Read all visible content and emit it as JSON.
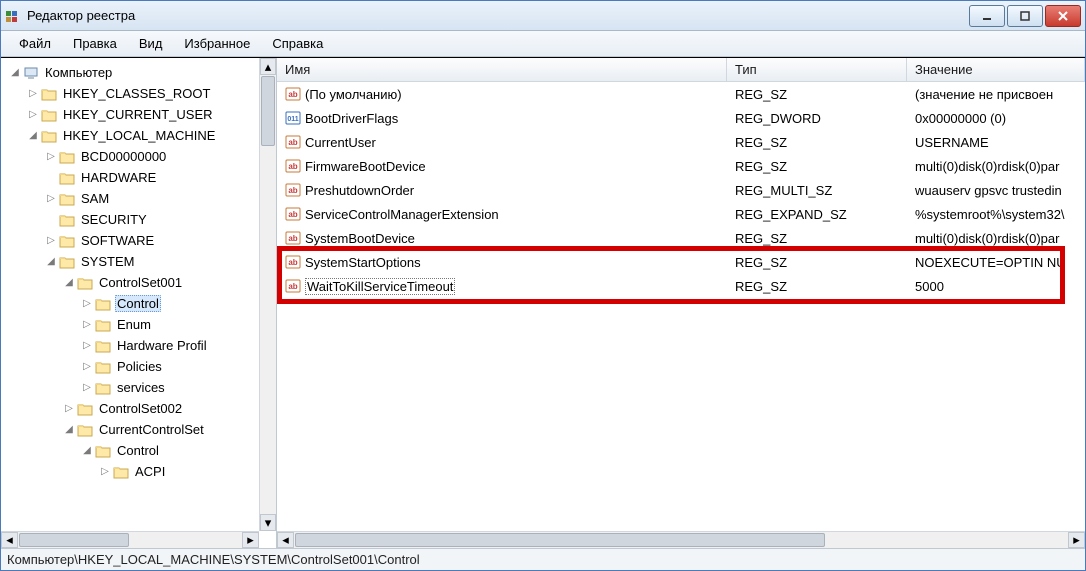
{
  "window": {
    "title": "Редактор реестра"
  },
  "menu": {
    "file": "Файл",
    "edit": "Правка",
    "view": "Вид",
    "favorites": "Избранное",
    "help": "Справка"
  },
  "tree": {
    "root": "Компьютер",
    "hkcr": "HKEY_CLASSES_ROOT",
    "hkcu": "HKEY_CURRENT_USER",
    "hklm": "HKEY_LOCAL_MACHINE",
    "bcd": "BCD00000000",
    "hardware": "HARDWARE",
    "sam": "SAM",
    "security": "SECURITY",
    "software": "SOFTWARE",
    "system": "SYSTEM",
    "cs001": "ControlSet001",
    "control": "Control",
    "enum": "Enum",
    "hwprofile": "Hardware Profil",
    "policies": "Policies",
    "services": "services",
    "cs002": "ControlSet002",
    "ccs": "CurrentControlSet",
    "control2": "Control",
    "acpi": "ACPI"
  },
  "list": {
    "headers": {
      "name": "Имя",
      "type": "Тип",
      "value": "Значение"
    },
    "rows": [
      {
        "name": "(По умолчанию)",
        "type": "REG_SZ",
        "value": "(значение не присвоен",
        "icon": "sz"
      },
      {
        "name": "BootDriverFlags",
        "type": "REG_DWORD",
        "value": "0x00000000 (0)",
        "icon": "bin"
      },
      {
        "name": "CurrentUser",
        "type": "REG_SZ",
        "value": "USERNAME",
        "icon": "sz"
      },
      {
        "name": "FirmwareBootDevice",
        "type": "REG_SZ",
        "value": "multi(0)disk(0)rdisk(0)par",
        "icon": "sz"
      },
      {
        "name": "PreshutdownOrder",
        "type": "REG_MULTI_SZ",
        "value": "wuauserv gpsvc trustedin",
        "icon": "sz"
      },
      {
        "name": "ServiceControlManagerExtension",
        "type": "REG_EXPAND_SZ",
        "value": "%systemroot%\\system32\\",
        "icon": "sz"
      },
      {
        "name": "SystemBootDevice",
        "type": "REG_SZ",
        "value": "multi(0)disk(0)rdisk(0)par",
        "icon": "sz"
      },
      {
        "name": "SystemStartOptions",
        "type": "REG_SZ",
        "value": " NOEXECUTE=OPTIN  NU",
        "icon": "sz"
      },
      {
        "name": "WaitToKillServiceTimeout",
        "type": "REG_SZ",
        "value": "5000",
        "icon": "sz",
        "highlighted": true,
        "dotted": true
      }
    ]
  },
  "statusbar": "Компьютер\\HKEY_LOCAL_MACHINE\\SYSTEM\\ControlSet001\\Control"
}
